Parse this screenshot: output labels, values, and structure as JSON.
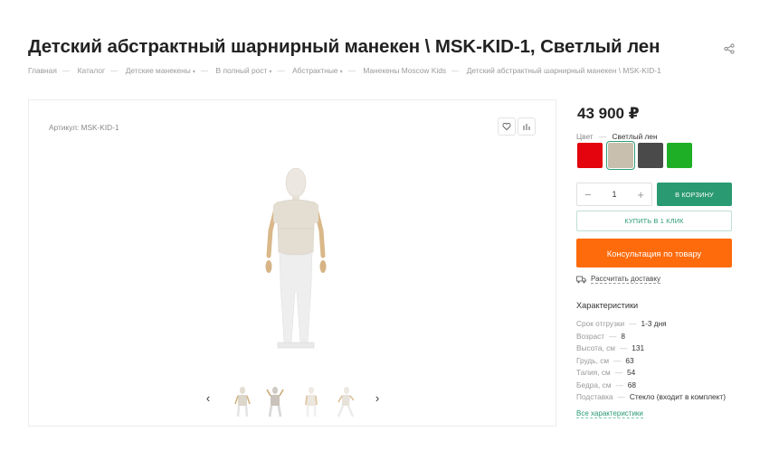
{
  "product": {
    "title": "Детский абстрактный шарнирный манекен \\ MSK-KID-1, Светлый лен",
    "sku_label": "Артикул: MSK-KID-1",
    "price": "43 900 ₽"
  },
  "breadcrumbs": [
    "Главная",
    "Каталог",
    "Детские манекены",
    "В полный рост",
    "Абстрактные",
    "Манекены Moscow Kids",
    "Детский абстрактный шарнирный манекен \\ MSK-KID-1"
  ],
  "breadcrumb_dropdown_glyph": "▾",
  "colors": {
    "label": "Цвет",
    "dash": "—",
    "selected": "Светлый лен",
    "swatches": [
      {
        "name": "red",
        "hex": "#e3040d"
      },
      {
        "name": "light-linen",
        "hex": "#c9bfae"
      },
      {
        "name": "dark-gray",
        "hex": "#4a4a4a"
      },
      {
        "name": "green",
        "hex": "#1faf27"
      }
    ]
  },
  "quantity": {
    "minus": "−",
    "value": "1",
    "plus": "+"
  },
  "buttons": {
    "cart": "В КОРЗИНУ",
    "one_click": "КУПИТЬ В 1 КЛИК",
    "consult": "Консультация по товару",
    "delivery": "Рассчитать доставку"
  },
  "gallery": {
    "prev": "‹",
    "next": "›"
  },
  "specs": {
    "title": "Характеристики",
    "dash": "—",
    "rows": [
      {
        "label": "Срок отгрузки",
        "value": "1-3 дня"
      },
      {
        "label": "Возраст",
        "value": "8"
      },
      {
        "label": "Высота, см",
        "value": "131"
      },
      {
        "label": "Грудь, см",
        "value": "63"
      },
      {
        "label": "Талия, см",
        "value": "54"
      },
      {
        "label": "Бедра, см",
        "value": "68"
      },
      {
        "label": "Подставка",
        "value": "Стекло (входит в комплект)"
      }
    ],
    "all_link": "Все характеристики"
  },
  "icons": {
    "share": "share-icon",
    "favorite": "heart-icon",
    "compare": "bar-chart-icon",
    "delivery": "truck-icon"
  }
}
